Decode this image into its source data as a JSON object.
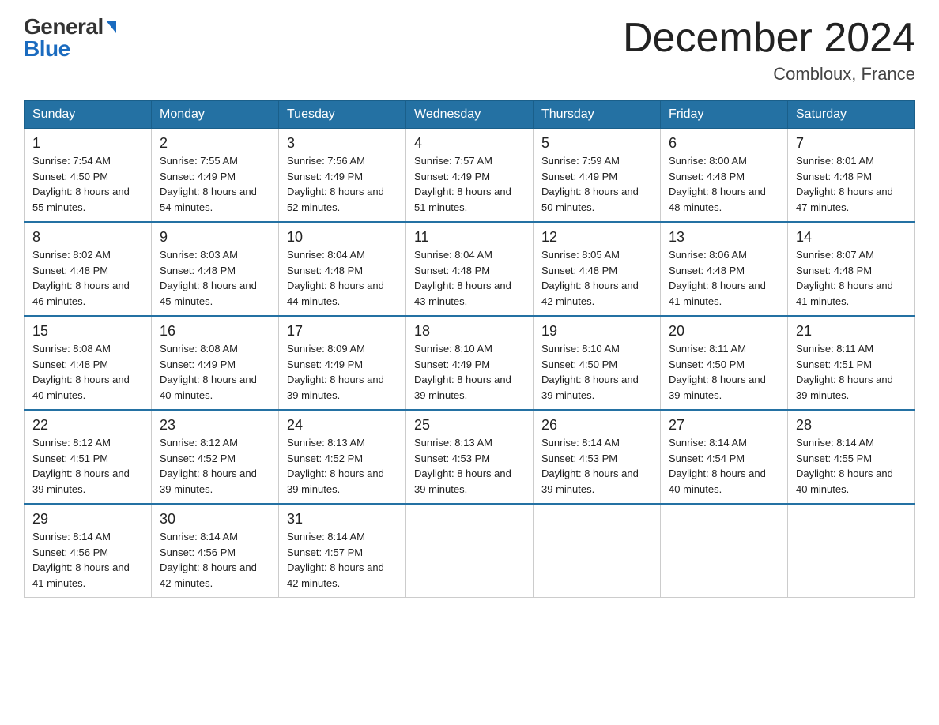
{
  "header": {
    "logo_general": "General",
    "logo_blue": "Blue",
    "month_title": "December 2024",
    "location": "Combloux, France"
  },
  "days_of_week": [
    "Sunday",
    "Monday",
    "Tuesday",
    "Wednesday",
    "Thursday",
    "Friday",
    "Saturday"
  ],
  "weeks": [
    [
      {
        "num": "1",
        "sunrise": "7:54 AM",
        "sunset": "4:50 PM",
        "daylight": "8 hours and 55 minutes."
      },
      {
        "num": "2",
        "sunrise": "7:55 AM",
        "sunset": "4:49 PM",
        "daylight": "8 hours and 54 minutes."
      },
      {
        "num": "3",
        "sunrise": "7:56 AM",
        "sunset": "4:49 PM",
        "daylight": "8 hours and 52 minutes."
      },
      {
        "num": "4",
        "sunrise": "7:57 AM",
        "sunset": "4:49 PM",
        "daylight": "8 hours and 51 minutes."
      },
      {
        "num": "5",
        "sunrise": "7:59 AM",
        "sunset": "4:49 PM",
        "daylight": "8 hours and 50 minutes."
      },
      {
        "num": "6",
        "sunrise": "8:00 AM",
        "sunset": "4:48 PM",
        "daylight": "8 hours and 48 minutes."
      },
      {
        "num": "7",
        "sunrise": "8:01 AM",
        "sunset": "4:48 PM",
        "daylight": "8 hours and 47 minutes."
      }
    ],
    [
      {
        "num": "8",
        "sunrise": "8:02 AM",
        "sunset": "4:48 PM",
        "daylight": "8 hours and 46 minutes."
      },
      {
        "num": "9",
        "sunrise": "8:03 AM",
        "sunset": "4:48 PM",
        "daylight": "8 hours and 45 minutes."
      },
      {
        "num": "10",
        "sunrise": "8:04 AM",
        "sunset": "4:48 PM",
        "daylight": "8 hours and 44 minutes."
      },
      {
        "num": "11",
        "sunrise": "8:04 AM",
        "sunset": "4:48 PM",
        "daylight": "8 hours and 43 minutes."
      },
      {
        "num": "12",
        "sunrise": "8:05 AM",
        "sunset": "4:48 PM",
        "daylight": "8 hours and 42 minutes."
      },
      {
        "num": "13",
        "sunrise": "8:06 AM",
        "sunset": "4:48 PM",
        "daylight": "8 hours and 41 minutes."
      },
      {
        "num": "14",
        "sunrise": "8:07 AM",
        "sunset": "4:48 PM",
        "daylight": "8 hours and 41 minutes."
      }
    ],
    [
      {
        "num": "15",
        "sunrise": "8:08 AM",
        "sunset": "4:48 PM",
        "daylight": "8 hours and 40 minutes."
      },
      {
        "num": "16",
        "sunrise": "8:08 AM",
        "sunset": "4:49 PM",
        "daylight": "8 hours and 40 minutes."
      },
      {
        "num": "17",
        "sunrise": "8:09 AM",
        "sunset": "4:49 PM",
        "daylight": "8 hours and 39 minutes."
      },
      {
        "num": "18",
        "sunrise": "8:10 AM",
        "sunset": "4:49 PM",
        "daylight": "8 hours and 39 minutes."
      },
      {
        "num": "19",
        "sunrise": "8:10 AM",
        "sunset": "4:50 PM",
        "daylight": "8 hours and 39 minutes."
      },
      {
        "num": "20",
        "sunrise": "8:11 AM",
        "sunset": "4:50 PM",
        "daylight": "8 hours and 39 minutes."
      },
      {
        "num": "21",
        "sunrise": "8:11 AM",
        "sunset": "4:51 PM",
        "daylight": "8 hours and 39 minutes."
      }
    ],
    [
      {
        "num": "22",
        "sunrise": "8:12 AM",
        "sunset": "4:51 PM",
        "daylight": "8 hours and 39 minutes."
      },
      {
        "num": "23",
        "sunrise": "8:12 AM",
        "sunset": "4:52 PM",
        "daylight": "8 hours and 39 minutes."
      },
      {
        "num": "24",
        "sunrise": "8:13 AM",
        "sunset": "4:52 PM",
        "daylight": "8 hours and 39 minutes."
      },
      {
        "num": "25",
        "sunrise": "8:13 AM",
        "sunset": "4:53 PM",
        "daylight": "8 hours and 39 minutes."
      },
      {
        "num": "26",
        "sunrise": "8:14 AM",
        "sunset": "4:53 PM",
        "daylight": "8 hours and 39 minutes."
      },
      {
        "num": "27",
        "sunrise": "8:14 AM",
        "sunset": "4:54 PM",
        "daylight": "8 hours and 40 minutes."
      },
      {
        "num": "28",
        "sunrise": "8:14 AM",
        "sunset": "4:55 PM",
        "daylight": "8 hours and 40 minutes."
      }
    ],
    [
      {
        "num": "29",
        "sunrise": "8:14 AM",
        "sunset": "4:56 PM",
        "daylight": "8 hours and 41 minutes."
      },
      {
        "num": "30",
        "sunrise": "8:14 AM",
        "sunset": "4:56 PM",
        "daylight": "8 hours and 42 minutes."
      },
      {
        "num": "31",
        "sunrise": "8:14 AM",
        "sunset": "4:57 PM",
        "daylight": "8 hours and 42 minutes."
      },
      null,
      null,
      null,
      null
    ]
  ]
}
